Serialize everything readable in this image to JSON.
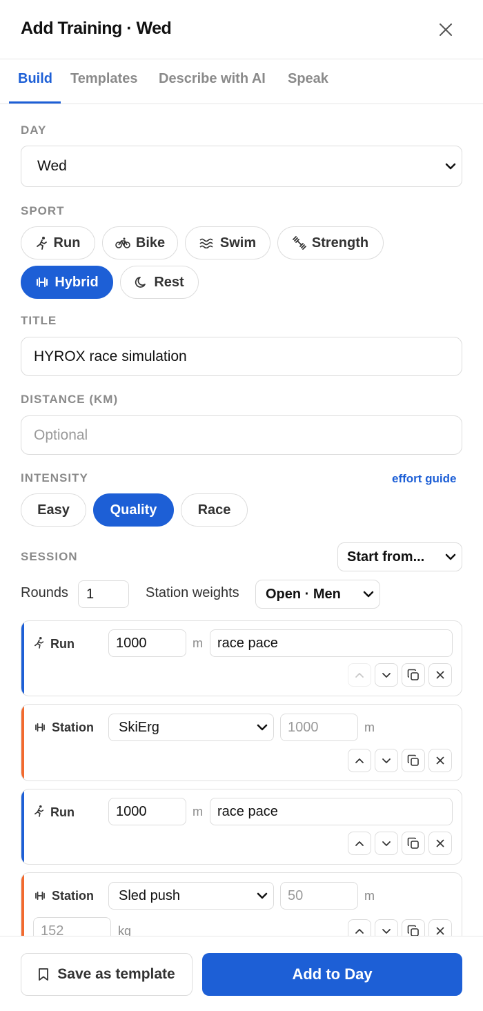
{
  "header": {
    "title": "Add Training · Wed",
    "close_icon": "close-icon"
  },
  "tabs": [
    {
      "label": "Build",
      "active": true
    },
    {
      "label": "Templates",
      "active": false
    },
    {
      "label": "Describe with AI",
      "active": false
    },
    {
      "label": "Speak",
      "active": false
    }
  ],
  "day": {
    "label": "DAY",
    "value": "Wed"
  },
  "sport": {
    "label": "SPORT",
    "options": [
      {
        "label": "Run",
        "icon": "runner-icon",
        "active": false
      },
      {
        "label": "Bike",
        "icon": "bike-icon",
        "active": false
      },
      {
        "label": "Swim",
        "icon": "waves-icon",
        "active": false
      },
      {
        "label": "Strength",
        "icon": "dumbbell-icon",
        "active": false
      },
      {
        "label": "Hybrid",
        "icon": "hybrid-icon",
        "active": true
      },
      {
        "label": "Rest",
        "icon": "moon-icon",
        "active": false
      }
    ]
  },
  "title_field": {
    "label": "TITLE",
    "value": "HYROX race simulation"
  },
  "distance_field": {
    "label": "DISTANCE (KM)",
    "placeholder": "Optional"
  },
  "intensity": {
    "label": "INTENSITY",
    "guide_link": "effort guide",
    "options": [
      {
        "label": "Easy",
        "active": false
      },
      {
        "label": "Quality",
        "active": true
      },
      {
        "label": "Race",
        "active": false
      }
    ]
  },
  "session": {
    "label": "SESSION",
    "start_from": "Start from...",
    "rounds_label": "Rounds",
    "rounds_value": "1",
    "weights_label": "Station weights",
    "weights_value": "Open · Men"
  },
  "steps": [
    {
      "kind": "Run",
      "distance": "1000",
      "unit": "m",
      "note": "race pace"
    },
    {
      "kind": "Station",
      "station": "SkiErg",
      "distance": "1000",
      "unit": "m"
    },
    {
      "kind": "Run",
      "distance": "1000",
      "unit": "m",
      "note": "race pace"
    },
    {
      "kind": "Station",
      "station": "Sled push",
      "distance": "50",
      "unit": "m",
      "weight": "152",
      "weight_unit": "kg"
    }
  ],
  "footer": {
    "save_template": "Save as template",
    "add_to_day": "Add to Day"
  },
  "colors": {
    "accent": "#1d5fd6",
    "run_bar": "#1d5fd6",
    "station_bar": "#f26a2e"
  }
}
